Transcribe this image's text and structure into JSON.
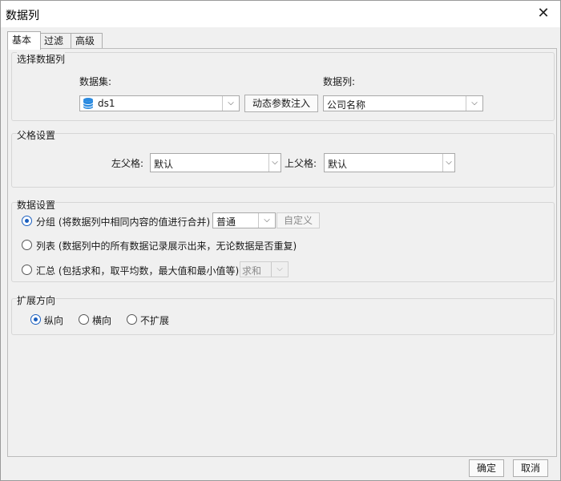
{
  "window": {
    "title": "数据列"
  },
  "tabs": [
    {
      "label": "基本",
      "active": true
    },
    {
      "label": "过滤",
      "active": false
    },
    {
      "label": "高级",
      "active": false
    }
  ],
  "select_column": {
    "title": "选择数据列",
    "dataset_label": "数据集:",
    "dataset_value": "ds1",
    "dynamic_param_button": "动态参数注入",
    "column_label": "数据列:",
    "column_value": "公司名称"
  },
  "parent_settings": {
    "title": "父格设置",
    "left_parent_label": "左父格:",
    "left_parent_value": "默认",
    "top_parent_label": "上父格:",
    "top_parent_value": "默认"
  },
  "data_settings": {
    "title": "数据设置",
    "options": [
      {
        "label": "分组 (将数据列中相同内容的值进行合并)",
        "checked": true
      },
      {
        "label": "列表 (数据列中的所有数据记录展示出来，无论数据是否重复)",
        "checked": false
      },
      {
        "label": "汇总 (包括求和，取平均数，最大值和最小值等)",
        "checked": false
      }
    ],
    "group_mode_value": "普通",
    "custom_button": "自定义",
    "summary_value": "求和"
  },
  "expand_direction": {
    "title": "扩展方向",
    "options": [
      {
        "label": "纵向",
        "checked": true
      },
      {
        "label": "横向",
        "checked": false
      },
      {
        "label": "不扩展",
        "checked": false
      }
    ]
  },
  "footer": {
    "ok_label": "确定",
    "cancel_label": "取消"
  },
  "colors": {
    "accent": "#1b5fbf",
    "dataset_icon": "#2a8ae0"
  }
}
